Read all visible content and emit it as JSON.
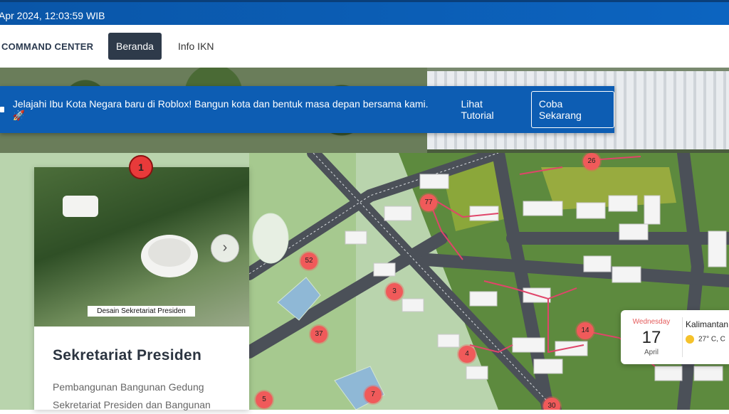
{
  "topbar": {
    "datetime": "Apr 2024, 12:03:59 WIB"
  },
  "nav": {
    "brand": "COMMAND CENTER",
    "items": [
      {
        "label": "Beranda",
        "active": true
      },
      {
        "label": "Info IKN",
        "active": false
      }
    ]
  },
  "banner": {
    "text": "Jelajahi Ibu Kota Negara baru di Roblox! Bangun kota dan bentuk masa depan bersama kami. 🚀",
    "tutorial": "Lihat Tutorial",
    "try_button": "Coba Sekarang"
  },
  "card": {
    "step": "1",
    "image_caption": "Desain Sekretariat Presiden",
    "title": "Sekretariat Presiden",
    "description": "Pembangunan Bangunan Gedung Sekretariat Presiden dan Bangunan",
    "next_icon": "chevron-right-icon"
  },
  "map_markers": [
    "26",
    "77",
    "52",
    "3",
    "37",
    "14",
    "4",
    "7",
    "5",
    "30"
  ],
  "weather": {
    "day": "Wednesday",
    "date": "17",
    "month": "April",
    "location": "Kalimantan",
    "temp": "27° C, C",
    "icon": "partly-sunny-icon"
  }
}
